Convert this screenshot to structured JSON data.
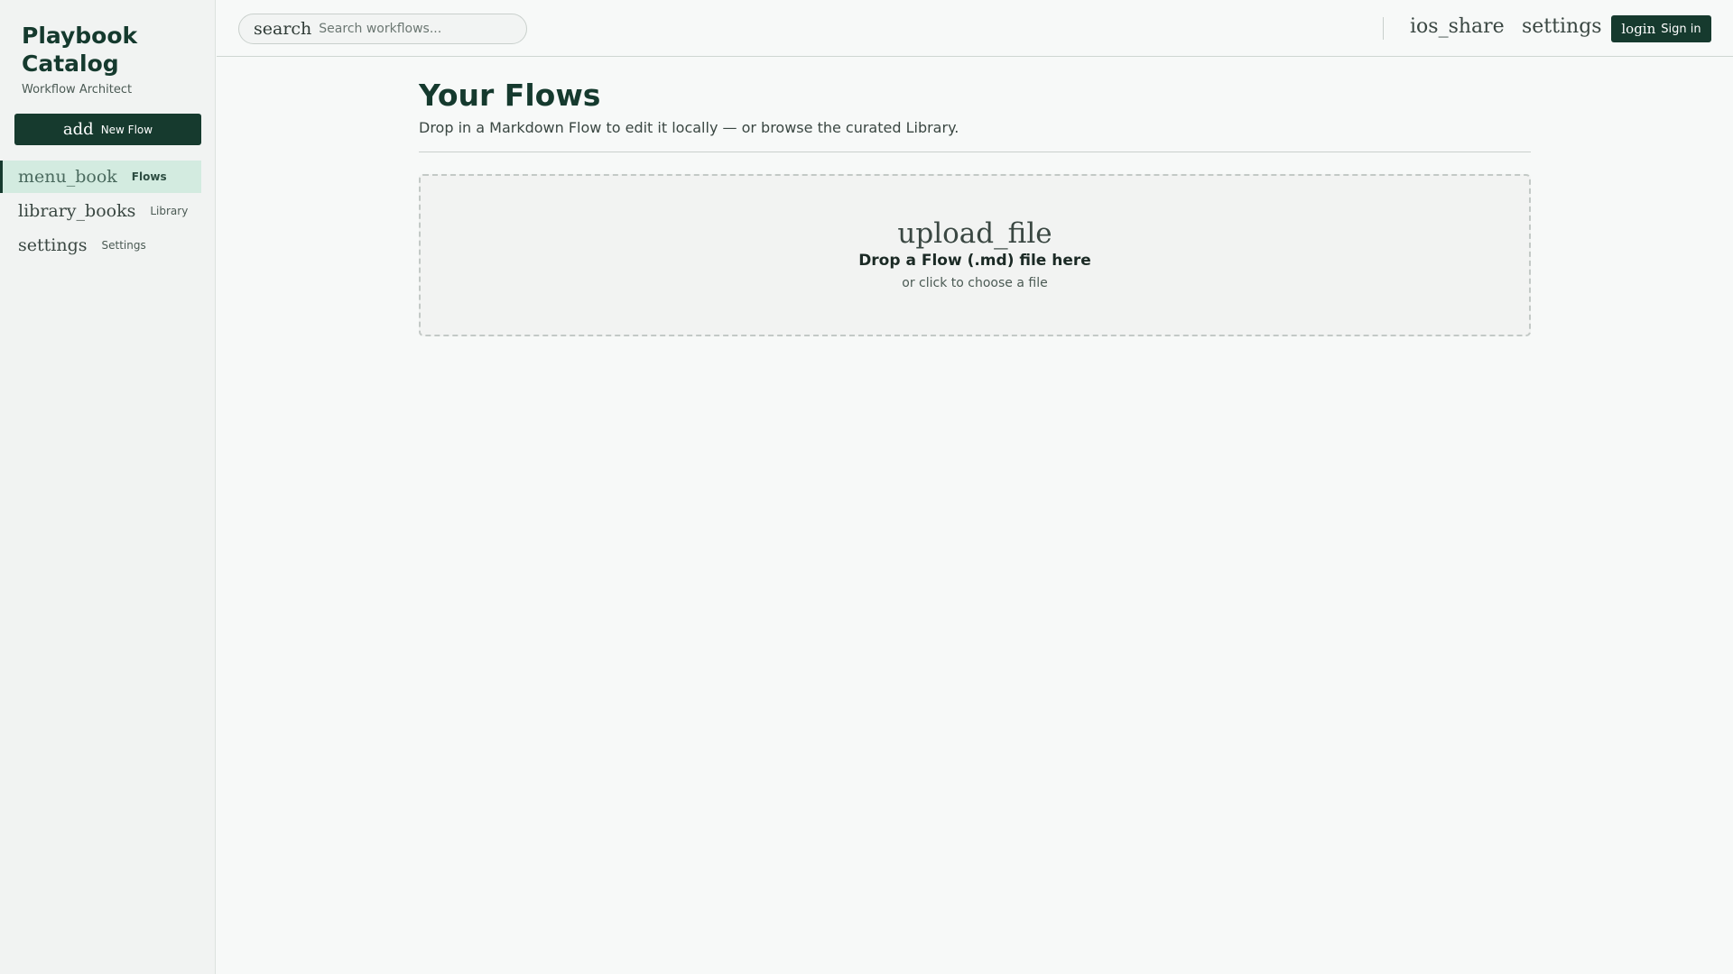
{
  "sidebar": {
    "brand_title": "Playbook Catalog",
    "brand_subtitle": "Workflow Architect",
    "new_flow": {
      "icon": "add",
      "label": "New Flow"
    },
    "items": [
      {
        "icon": "menu_book",
        "label": "Flows",
        "active": true
      },
      {
        "icon": "library_books",
        "label": "Library",
        "active": false
      },
      {
        "icon": "settings",
        "label": "Settings",
        "active": false
      }
    ]
  },
  "topbar": {
    "search_icon": "search",
    "search_placeholder": "Search workflows...",
    "share_icon": "ios_share",
    "settings_icon": "settings",
    "signin": {
      "icon": "login",
      "label": "Sign in"
    }
  },
  "main": {
    "title": "Your Flows",
    "subtitle": "Drop in a Markdown Flow to edit it locally — or browse the curated Library.",
    "dropzone": {
      "icon": "upload_file",
      "title": "Drop a Flow (.md) file here",
      "subtitle": "or click to choose a file"
    }
  },
  "colors": {
    "brand": "#163a2e",
    "active_bg": "#d3ebe0",
    "background": "#f7f9f8"
  }
}
